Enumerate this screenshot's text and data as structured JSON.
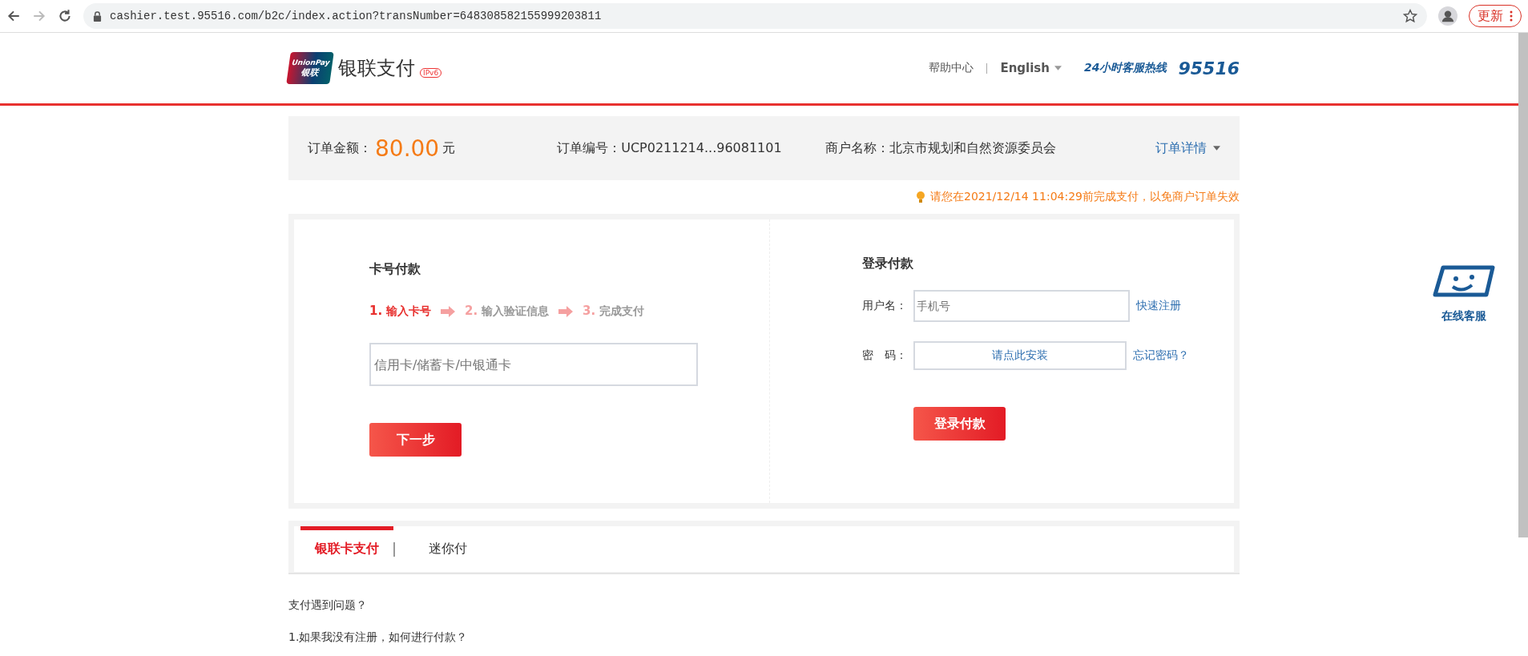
{
  "browser": {
    "url": "cashier.test.95516.com/b2c/index.action?transNumber=648308582155999203811",
    "update_button": "更新"
  },
  "header": {
    "logo_top": "UnionPay",
    "logo_bottom": "银联",
    "brand": "银联支付",
    "badge": "IPv6",
    "help": "帮助中心",
    "language": "English",
    "hotline_label": "24小时客服热线",
    "hotline_number": "95516"
  },
  "order": {
    "amount_label": "订单金额：",
    "amount": "80.00",
    "currency": "元",
    "number": "订单编号：UCP0211214...96081101",
    "merchant": "商户名称：北京市规划和自然资源委员会",
    "details": "订单详情"
  },
  "notice": "请您在2021/12/14 11:04:29前完成支付，以免商户订单失效",
  "card_pay": {
    "title": "卡号付款",
    "steps": [
      {
        "number": "1.",
        "label": "输入卡号",
        "selected": true
      },
      {
        "number": "2.",
        "label": "输入验证信息",
        "selected": false
      },
      {
        "number": "3.",
        "label": "完成支付",
        "selected": false
      }
    ],
    "card_placeholder": "信用卡/储蓄卡/中银通卡",
    "next_button": "下一步"
  },
  "login_pay": {
    "title": "登录付款",
    "username_label": "用户名：",
    "username_placeholder": "手机号",
    "register_link": "快速注册",
    "password_label": "密　码：",
    "install_button": "请点此安装",
    "forgot_link": "忘记密码？",
    "login_button": "登录付款"
  },
  "tabs": [
    {
      "label": "银联卡支付",
      "selected": true
    },
    {
      "label": "迷你付",
      "selected": false
    }
  ],
  "help": {
    "title": "支付遇到问题？",
    "questions": [
      "1.如果我没有注册，如何进行付款？"
    ]
  },
  "side": {
    "service_label": "在线客服"
  }
}
